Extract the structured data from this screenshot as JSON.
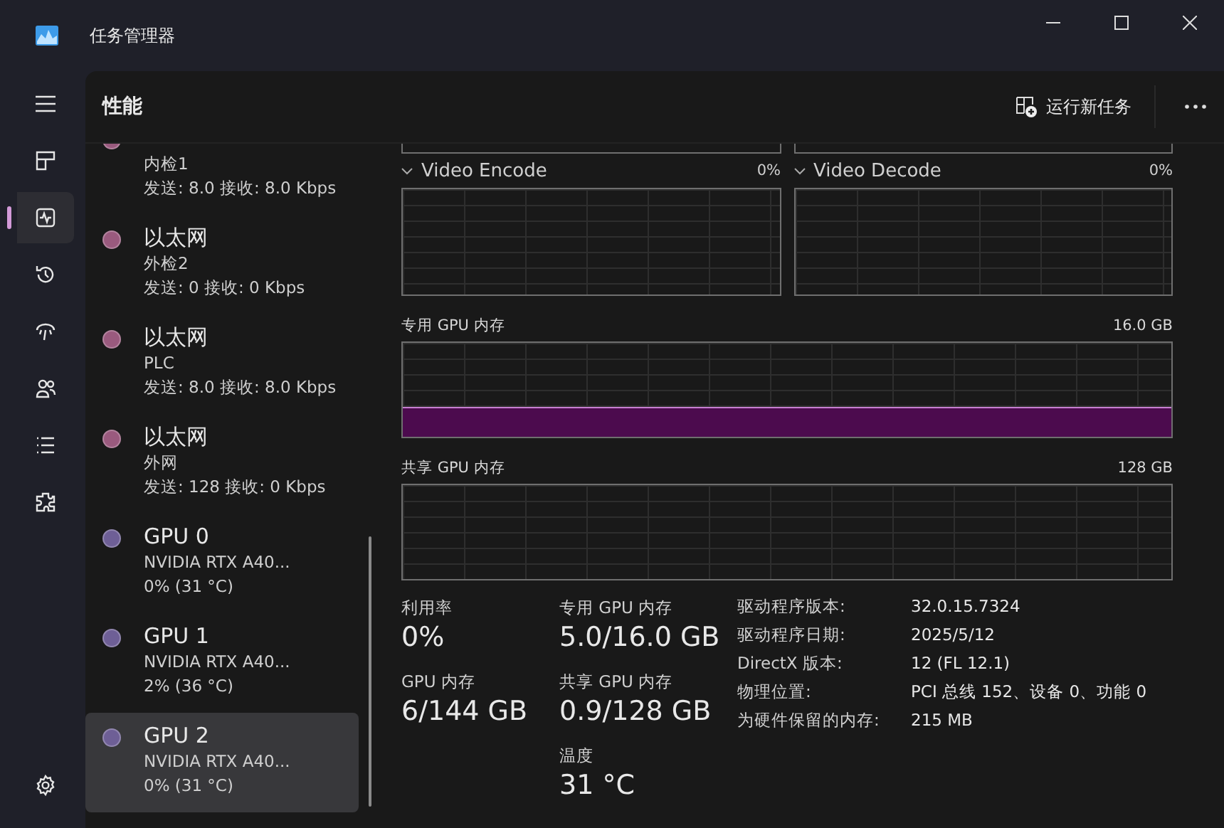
{
  "window": {
    "title": "任务管理器"
  },
  "nav": [
    {
      "kind": "menu",
      "selected": false
    },
    {
      "kind": "processes",
      "selected": false
    },
    {
      "kind": "performance",
      "selected": true
    },
    {
      "kind": "history",
      "selected": false
    },
    {
      "kind": "startup",
      "selected": false
    },
    {
      "kind": "users",
      "selected": false
    },
    {
      "kind": "details",
      "selected": false
    },
    {
      "kind": "services",
      "selected": false
    }
  ],
  "nav_bottom": {
    "kind": "settings",
    "selected": false
  },
  "header": {
    "title": "性能",
    "run_task": "运行新任务"
  },
  "devices": [
    {
      "subtitle": "内检1",
      "detail": "发送: 8.0 接收: 8.0 Kbps",
      "color": "#9a5a7e",
      "selected": false
    },
    {
      "title": "以太网",
      "subtitle": "外检2",
      "detail": "发送: 0 接收: 0 Kbps",
      "color": "#9a5a7e",
      "selected": false
    },
    {
      "title": "以太网",
      "subtitle": "PLC",
      "detail": "发送: 8.0 接收: 8.0 Kbps",
      "color": "#9a5a7e",
      "selected": false
    },
    {
      "title": "以太网",
      "subtitle": "外网",
      "detail": "发送: 128 接收: 0 Kbps",
      "color": "#9a5a7e",
      "selected": false
    },
    {
      "title": "GPU 0",
      "subtitle": "NVIDIA RTX A40...",
      "detail": "0% (31 °C)",
      "color": "#6e5f96",
      "selected": false
    },
    {
      "title": "GPU 1",
      "subtitle": "NVIDIA RTX A40...",
      "detail": "2% (36 °C)",
      "color": "#6e5f96",
      "selected": false
    },
    {
      "title": "GPU 2",
      "subtitle": "NVIDIA RTX A40...",
      "detail": "0% (31 °C)",
      "color": "#6e5f96",
      "selected": true
    }
  ],
  "engines": [
    {
      "name": "Video Encode",
      "reading": "0%"
    },
    {
      "name": "Video Decode",
      "reading": "0%"
    }
  ],
  "memory_graphs": [
    {
      "label": "专用 GPU 内存",
      "max": "16.0 GB",
      "kind": "used"
    },
    {
      "label": "共享 GPU 内存",
      "max": "128 GB",
      "kind": "idle"
    }
  ],
  "stat_columns": [
    [
      {
        "label": "利用率",
        "value": "0%"
      },
      {
        "label": "GPU 内存",
        "value": "6/144 GB"
      }
    ],
    [
      {
        "label": "专用 GPU 内存",
        "value": "5.0/16.0 GB"
      },
      {
        "label": "共享 GPU 内存",
        "value": "0.9/128 GB"
      },
      {
        "label": "温度",
        "value": "31 °C"
      }
    ]
  ],
  "properties": [
    {
      "label": "驱动程序版本:",
      "value": "32.0.15.7324"
    },
    {
      "label": "驱动程序日期:",
      "value": "2025/5/12"
    },
    {
      "label": "DirectX 版本:",
      "value": "12 (FL 12.1)"
    },
    {
      "label": "物理位置:",
      "value": "PCI 总线 152、设备 0、功能 0"
    },
    {
      "label": "为硬件保留的内存:",
      "value": "215 MB"
    }
  ]
}
